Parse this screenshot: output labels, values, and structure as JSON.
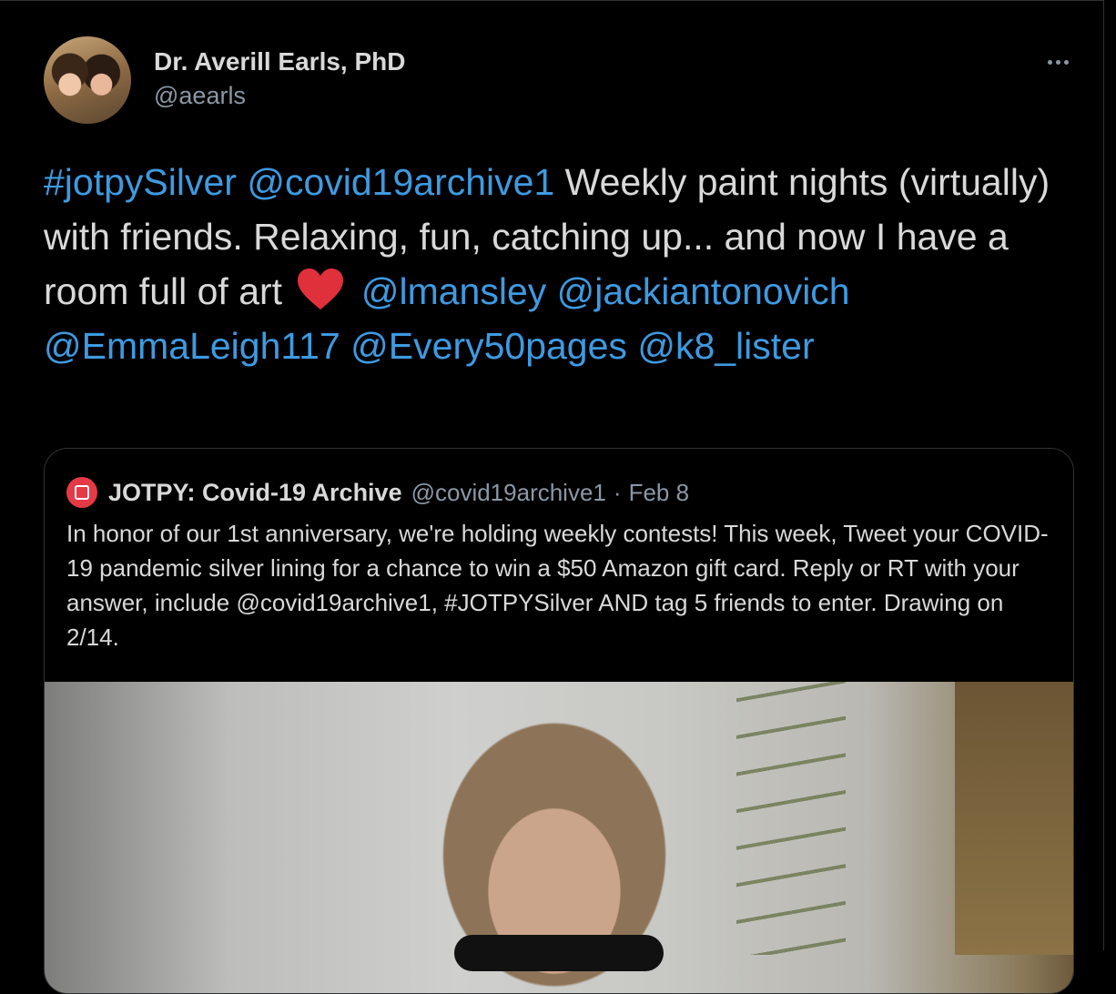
{
  "tweet": {
    "author_name": "Dr. Averill Earls, PhD",
    "author_handle": "@aearls",
    "text_parts": {
      "p1": "#jotpySilver",
      "p2": "@covid19archive1",
      "p3": " Weekly paint nights (virtually) with friends. Relaxing, fun, catching up... and now I have a room full of art ",
      "p4": "@lmansley",
      "p5": "@jackiantonovich",
      "p6": "@EmmaLeigh117",
      "p7": "@Every50pages",
      "p8": "@k8_lister"
    },
    "icons": {
      "more": "more-icon",
      "heart": "heart-emoji"
    }
  },
  "quoted_tweet": {
    "author_name": "JOTPY: Covid-19 Archive",
    "author_handle": "@covid19archive1",
    "separator": "·",
    "date": "Feb 8",
    "text": "In honor of our 1st anniversary, we're holding weekly contests! This week, Tweet your COVID-19 pandemic silver lining for a chance to win a $50 Amazon gift card. Reply or RT with your answer, include @covid19archive1, #JOTPYSilver AND tag 5 friends to enter. Drawing on 2/14."
  },
  "colors": {
    "background": "#000000",
    "text": "#d9d9d9",
    "secondary": "#8b98a5",
    "link": "#3e9ae0",
    "heart": "#e0303b"
  }
}
